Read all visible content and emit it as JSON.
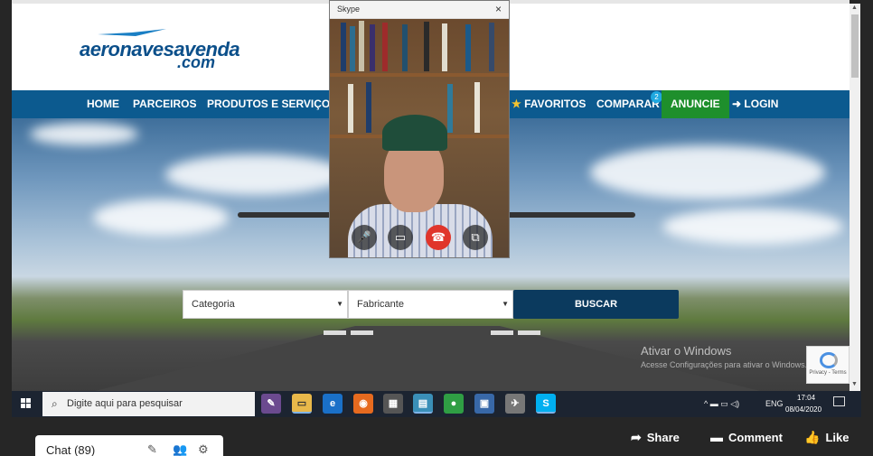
{
  "website": {
    "logo": {
      "main": "aeronavesavenda",
      "sub": ".com"
    },
    "nav": {
      "home": "HOME",
      "parceiros": "PARCEIROS",
      "produtos": "PRODUTOS E SERVIÇOS",
      "favoritos": "FAVORITOS",
      "comparar": "COMPARAR",
      "comparar_count": "2",
      "anuncie": "ANUNCIE",
      "login": "LOGIN"
    },
    "search": {
      "category": "Categoria",
      "manufacturer": "Fabricante",
      "button": "BUSCAR"
    },
    "watermark": {
      "title": "Ativar o Windows",
      "subtitle": "Acesse Configurações para ativar o Windows."
    },
    "recaptcha": "Privacy - Terms"
  },
  "skype": {
    "title": "Skype",
    "close": "×",
    "buttons": {
      "mic": "🎤",
      "video": "▭",
      "hangup": "☎",
      "popout": "⧉"
    }
  },
  "taskbar": {
    "search_placeholder": "Digite aqui para pesquisar",
    "tray_lang": "ENG",
    "time": "17:04",
    "date": "08/04/2020"
  },
  "stream_bar": {
    "chat_label": "Chat (89)",
    "share": "Share",
    "comment": "Comment",
    "like": "Like"
  },
  "colors": {
    "nav_blue": "#0c5a8f",
    "anuncie_green": "#1e8f2c",
    "buscar_navy": "#0b3a5e",
    "taskbar": "#1c2431"
  }
}
